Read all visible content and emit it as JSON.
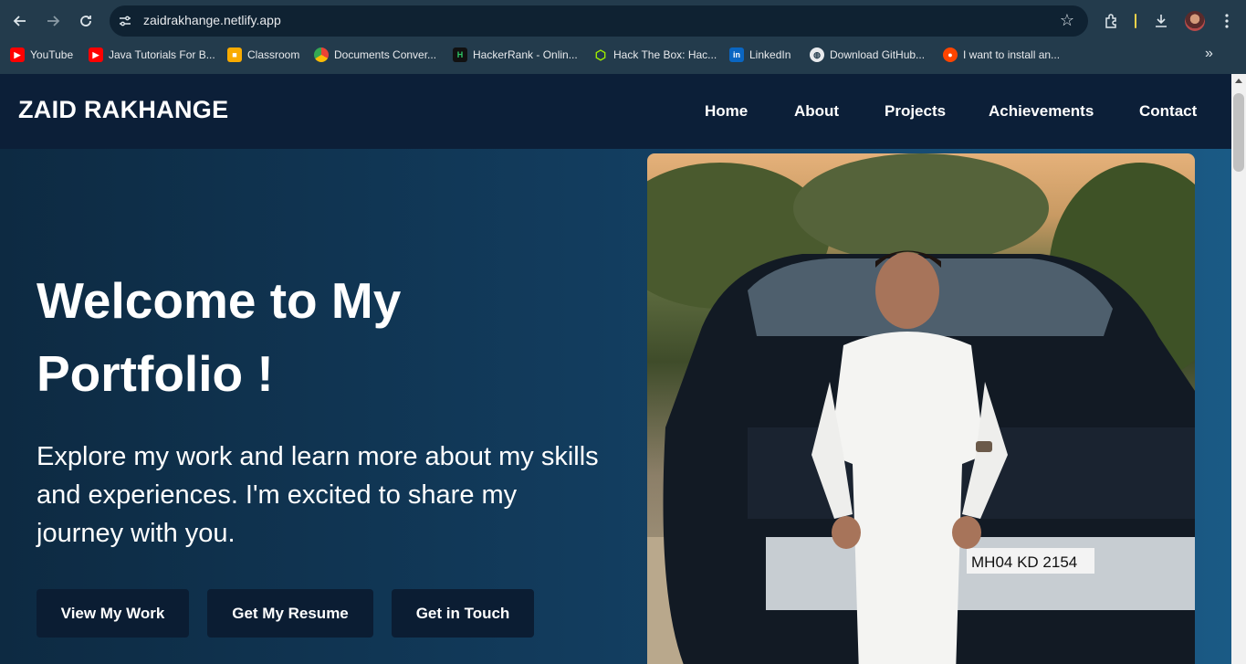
{
  "browser": {
    "url": "zaidrakhange.netlify.app",
    "bookmarks": [
      {
        "label": "YouTube",
        "icon": "youtube-icon",
        "color": "#ff0000"
      },
      {
        "label": "Java Tutorials For B...",
        "icon": "youtube-icon",
        "color": "#ff0000"
      },
      {
        "label": "Classroom",
        "icon": "classroom-icon",
        "color": "#f9ab00"
      },
      {
        "label": "Documents Conver...",
        "icon": "chrome-icon",
        "color": "#4285f4"
      },
      {
        "label": "HackerRank - Onlin...",
        "icon": "hackerrank-icon",
        "color": "#111111"
      },
      {
        "label": "Hack The Box: Hac...",
        "icon": "hackthebox-icon",
        "color": "#9fef00"
      },
      {
        "label": "LinkedIn",
        "icon": "linkedin-icon",
        "color": "#0a66c2"
      },
      {
        "label": "Download GitHub...",
        "icon": "globe-icon",
        "color": "#e8eaed"
      },
      {
        "label": "I want to install an...",
        "icon": "reddit-icon",
        "color": "#ff4500"
      }
    ]
  },
  "site": {
    "logo": "ZAID RAKHANGE",
    "nav": [
      "Home",
      "About",
      "Projects",
      "Achievements",
      "Contact"
    ],
    "hero": {
      "title": "Welcome to My Portfolio !",
      "subtitle": "Explore my work and learn more about my skills and experiences. I'm excited to share my journey with you.",
      "buttons": [
        "View My Work",
        "Get My Resume",
        "Get in Touch"
      ]
    }
  }
}
